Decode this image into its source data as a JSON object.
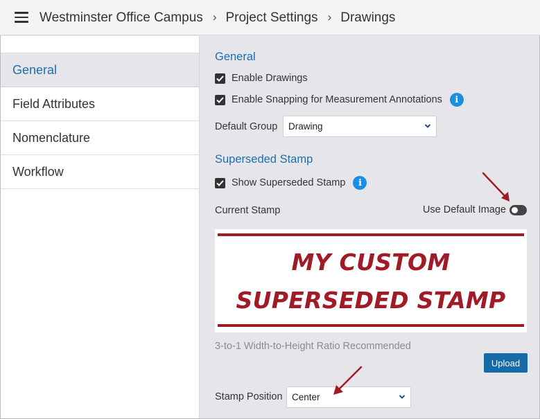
{
  "header": {
    "breadcrumb": [
      "Westminster Office Campus",
      "Project Settings",
      "Drawings"
    ]
  },
  "sidebar": {
    "items": [
      {
        "label": "General",
        "active": true
      },
      {
        "label": "Field Attributes",
        "active": false
      },
      {
        "label": "Nomenclature",
        "active": false
      },
      {
        "label": "Workflow",
        "active": false
      }
    ]
  },
  "general": {
    "title": "General",
    "enable_drawings": {
      "label": "Enable Drawings",
      "checked": true
    },
    "enable_snapping": {
      "label": "Enable Snapping for Measurement Annotations",
      "checked": true
    },
    "default_group": {
      "label": "Default Group",
      "value": "Drawing"
    }
  },
  "superseded": {
    "title": "Superseded Stamp",
    "show_stamp": {
      "label": "Show Superseded Stamp",
      "checked": true
    },
    "current_stamp_label": "Current Stamp",
    "use_default_label": "Use Default Image",
    "use_default_on": false,
    "stamp_line1": "MY CUSTOM",
    "stamp_line2": "SUPERSEDED STAMP",
    "ratio_hint": "3-to-1 Width-to-Height Ratio Recommended",
    "upload_label": "Upload",
    "position": {
      "label": "Stamp Position",
      "value": "Center"
    }
  },
  "colors": {
    "accent": "#1b6fb0",
    "stamp_red": "#a01b26",
    "info_blue": "#1c8ee0",
    "annotation_arrow": "#a01b26"
  },
  "icons": {
    "menu": "hamburger-menu-icon",
    "info": "info-icon",
    "check": "checkmark-icon",
    "chevron": "chevron-down-icon"
  }
}
